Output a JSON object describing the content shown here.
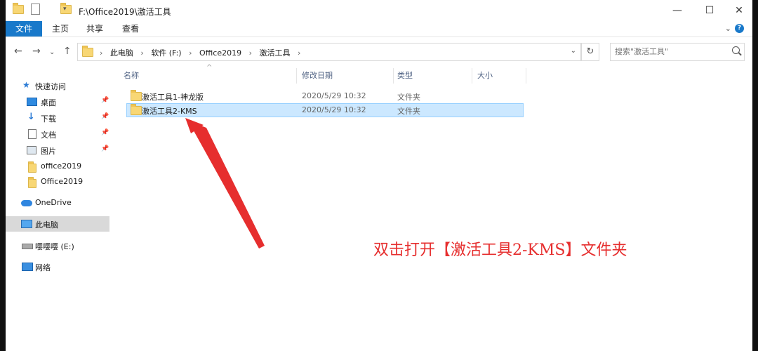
{
  "window": {
    "title": "F:\\Office2019\\激活工具",
    "controls": [
      "—",
      "☐",
      "✕"
    ]
  },
  "ribbon": {
    "file": "文件",
    "tabs": [
      "主页",
      "共享",
      "查看"
    ],
    "expand": "⌄",
    "help": "?"
  },
  "nav": {
    "back": "←",
    "forward": "→",
    "recent": "⌄",
    "up": "↑"
  },
  "address": {
    "crumbs": [
      "此电脑",
      "软件 (F:)",
      "Office2019",
      "激活工具"
    ],
    "sep": "›",
    "dropdown": "⌄",
    "refresh": "↻"
  },
  "search": {
    "placeholder": "搜索\"激活工具\""
  },
  "sidebar": {
    "quick_access": "快速访问",
    "items": [
      {
        "label": "桌面",
        "pinned": true
      },
      {
        "label": "下载",
        "pinned": true
      },
      {
        "label": "文档",
        "pinned": true
      },
      {
        "label": "图片",
        "pinned": true
      },
      {
        "label": "office2019",
        "pinned": false
      },
      {
        "label": "Office2019",
        "pinned": false
      }
    ],
    "onedrive": "OneDrive",
    "this_pc": "此电脑",
    "drive_e": "嘤嘤嘤 (E:)",
    "network": "网络",
    "pin_glyph": "📌"
  },
  "columns": {
    "name": "名称",
    "modified": "修改日期",
    "type": "类型",
    "size": "大小",
    "sort_glyph": "^"
  },
  "files": [
    {
      "name": "激活工具1-神龙版",
      "modified": "2020/5/29 10:32",
      "type": "文件夹",
      "selected": false
    },
    {
      "name": "激活工具2-KMS",
      "modified": "2020/5/29 10:32",
      "type": "文件夹",
      "selected": true
    }
  ],
  "annotation": {
    "text": "双击打开【激活工具2-KMS】文件夹",
    "color": "#e62e2e"
  },
  "colors": {
    "accent": "#1979ca",
    "selection": "#cce8ff"
  }
}
